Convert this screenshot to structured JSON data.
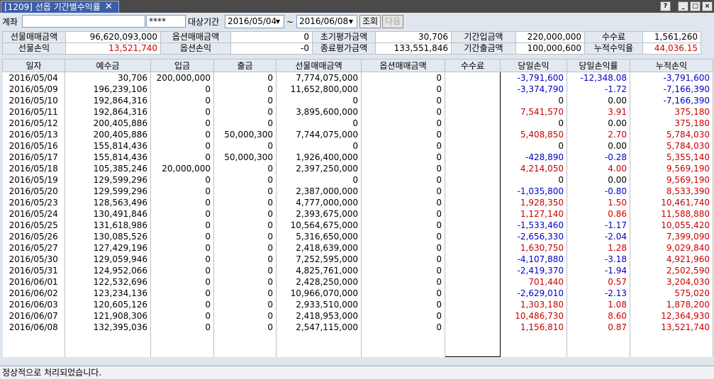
{
  "window": {
    "tab_title": "[1209] 선옵 기간별수익률",
    "help": "?",
    "minimize": "_",
    "restore": "□",
    "close": "×"
  },
  "toolbar": {
    "account_label": "계좌",
    "account_value": "",
    "password_value": "****",
    "period_label": "대상기간",
    "from_date": "2016/05/04",
    "tilde": "~",
    "to_date": "2016/06/08",
    "query_button": "조회",
    "next_button": "다음"
  },
  "summary": {
    "row1": [
      {
        "label": "선물매매금액",
        "value": "96,620,093,000",
        "red": false
      },
      {
        "label": "옵션매매금액",
        "value": "0",
        "red": false
      },
      {
        "label": "초기평가금액",
        "value": "30,706",
        "red": false
      },
      {
        "label": "기간입금액",
        "value": "220,000,000",
        "red": false
      },
      {
        "label": "수수료",
        "value": "1,561,260",
        "red": false
      }
    ],
    "row2": [
      {
        "label": "선물손익",
        "value": "13,521,740",
        "red": true
      },
      {
        "label": "옵션손익",
        "value": "-0",
        "red": false
      },
      {
        "label": "종료평가금액",
        "value": "133,551,846",
        "red": false
      },
      {
        "label": "기간출금액",
        "value": "100,000,600",
        "red": false
      },
      {
        "label": "누적수익율",
        "value": "44,036.15",
        "red": true
      }
    ]
  },
  "grid": {
    "headers": [
      "일자",
      "예수금",
      "입금",
      "출금",
      "선물매매금액",
      "옵션매매금액",
      "수수료",
      "당일손익",
      "당일손익률",
      "누적손익"
    ],
    "rows": [
      {
        "date": "2016/05/04",
        "deposit": "30,706",
        "in": "200,000,000",
        "out": "0",
        "fut": "7,774,075,000",
        "opt": "0",
        "fee": "",
        "pl": "-3,791,600",
        "rate": "-12,348.08",
        "cum": "-3,791,600",
        "plc": "neg",
        "ratec": "neg",
        "cumc": "neg"
      },
      {
        "date": "2016/05/09",
        "deposit": "196,239,106",
        "in": "0",
        "out": "0",
        "fut": "11,652,800,000",
        "opt": "0",
        "fee": "",
        "pl": "-3,374,790",
        "rate": "-1.72",
        "cum": "-7,166,390",
        "plc": "neg",
        "ratec": "neg",
        "cumc": "neg"
      },
      {
        "date": "2016/05/10",
        "deposit": "192,864,316",
        "in": "0",
        "out": "0",
        "fut": "0",
        "opt": "0",
        "fee": "",
        "pl": "0",
        "rate": "0.00",
        "cum": "-7,166,390",
        "plc": "blk",
        "ratec": "blk",
        "cumc": "neg"
      },
      {
        "date": "2016/05/11",
        "deposit": "192,864,316",
        "in": "0",
        "out": "0",
        "fut": "3,895,600,000",
        "opt": "0",
        "fee": "",
        "pl": "7,541,570",
        "rate": "3.91",
        "cum": "375,180",
        "plc": "pos",
        "ratec": "pos",
        "cumc": "pos"
      },
      {
        "date": "2016/05/12",
        "deposit": "200,405,886",
        "in": "0",
        "out": "0",
        "fut": "0",
        "opt": "0",
        "fee": "",
        "pl": "0",
        "rate": "0.00",
        "cum": "375,180",
        "plc": "blk",
        "ratec": "blk",
        "cumc": "pos"
      },
      {
        "date": "2016/05/13",
        "deposit": "200,405,886",
        "in": "0",
        "out": "50,000,300",
        "fut": "7,744,075,000",
        "opt": "0",
        "fee": "",
        "pl": "5,408,850",
        "rate": "2.70",
        "cum": "5,784,030",
        "plc": "pos",
        "ratec": "pos",
        "cumc": "pos"
      },
      {
        "date": "2016/05/16",
        "deposit": "155,814,436",
        "in": "0",
        "out": "0",
        "fut": "0",
        "opt": "0",
        "fee": "",
        "pl": "0",
        "rate": "0.00",
        "cum": "5,784,030",
        "plc": "blk",
        "ratec": "blk",
        "cumc": "pos"
      },
      {
        "date": "2016/05/17",
        "deposit": "155,814,436",
        "in": "0",
        "out": "50,000,300",
        "fut": "1,926,400,000",
        "opt": "0",
        "fee": "",
        "pl": "-428,890",
        "rate": "-0.28",
        "cum": "5,355,140",
        "plc": "neg",
        "ratec": "neg",
        "cumc": "pos"
      },
      {
        "date": "2016/05/18",
        "deposit": "105,385,246",
        "in": "20,000,000",
        "out": "0",
        "fut": "2,397,250,000",
        "opt": "0",
        "fee": "",
        "pl": "4,214,050",
        "rate": "4.00",
        "cum": "9,569,190",
        "plc": "pos",
        "ratec": "pos",
        "cumc": "pos"
      },
      {
        "date": "2016/05/19",
        "deposit": "129,599,296",
        "in": "0",
        "out": "0",
        "fut": "0",
        "opt": "0",
        "fee": "",
        "pl": "0",
        "rate": "0.00",
        "cum": "9,569,190",
        "plc": "blk",
        "ratec": "blk",
        "cumc": "pos"
      },
      {
        "date": "2016/05/20",
        "deposit": "129,599,296",
        "in": "0",
        "out": "0",
        "fut": "2,387,000,000",
        "opt": "0",
        "fee": "",
        "pl": "-1,035,800",
        "rate": "-0.80",
        "cum": "8,533,390",
        "plc": "neg",
        "ratec": "neg",
        "cumc": "pos"
      },
      {
        "date": "2016/05/23",
        "deposit": "128,563,496",
        "in": "0",
        "out": "0",
        "fut": "4,777,000,000",
        "opt": "0",
        "fee": "",
        "pl": "1,928,350",
        "rate": "1.50",
        "cum": "10,461,740",
        "plc": "pos",
        "ratec": "pos",
        "cumc": "pos"
      },
      {
        "date": "2016/05/24",
        "deposit": "130,491,846",
        "in": "0",
        "out": "0",
        "fut": "2,393,675,000",
        "opt": "0",
        "fee": "",
        "pl": "1,127,140",
        "rate": "0.86",
        "cum": "11,588,880",
        "plc": "pos",
        "ratec": "pos",
        "cumc": "pos"
      },
      {
        "date": "2016/05/25",
        "deposit": "131,618,986",
        "in": "0",
        "out": "0",
        "fut": "10,564,675,000",
        "opt": "0",
        "fee": "",
        "pl": "-1,533,460",
        "rate": "-1.17",
        "cum": "10,055,420",
        "plc": "neg",
        "ratec": "neg",
        "cumc": "pos"
      },
      {
        "date": "2016/05/26",
        "deposit": "130,085,526",
        "in": "0",
        "out": "0",
        "fut": "5,316,650,000",
        "opt": "0",
        "fee": "",
        "pl": "-2,656,330",
        "rate": "-2.04",
        "cum": "7,399,090",
        "plc": "neg",
        "ratec": "neg",
        "cumc": "pos"
      },
      {
        "date": "2016/05/27",
        "deposit": "127,429,196",
        "in": "0",
        "out": "0",
        "fut": "2,418,639,000",
        "opt": "0",
        "fee": "",
        "pl": "1,630,750",
        "rate": "1.28",
        "cum": "9,029,840",
        "plc": "pos",
        "ratec": "pos",
        "cumc": "pos"
      },
      {
        "date": "2016/05/30",
        "deposit": "129,059,946",
        "in": "0",
        "out": "0",
        "fut": "7,252,595,000",
        "opt": "0",
        "fee": "",
        "pl": "-4,107,880",
        "rate": "-3.18",
        "cum": "4,921,960",
        "plc": "neg",
        "ratec": "neg",
        "cumc": "pos"
      },
      {
        "date": "2016/05/31",
        "deposit": "124,952,066",
        "in": "0",
        "out": "0",
        "fut": "4,825,761,000",
        "opt": "0",
        "fee": "",
        "pl": "-2,419,370",
        "rate": "-1.94",
        "cum": "2,502,590",
        "plc": "neg",
        "ratec": "neg",
        "cumc": "pos"
      },
      {
        "date": "2016/06/01",
        "deposit": "122,532,696",
        "in": "0",
        "out": "0",
        "fut": "2,428,250,000",
        "opt": "0",
        "fee": "",
        "pl": "701,440",
        "rate": "0.57",
        "cum": "3,204,030",
        "plc": "pos",
        "ratec": "pos",
        "cumc": "pos"
      },
      {
        "date": "2016/06/02",
        "deposit": "123,234,136",
        "in": "0",
        "out": "0",
        "fut": "10,966,070,000",
        "opt": "0",
        "fee": "",
        "pl": "-2,629,010",
        "rate": "-2.13",
        "cum": "575,020",
        "plc": "neg",
        "ratec": "neg",
        "cumc": "pos"
      },
      {
        "date": "2016/06/03",
        "deposit": "120,605,126",
        "in": "0",
        "out": "0",
        "fut": "2,933,510,000",
        "opt": "0",
        "fee": "",
        "pl": "1,303,180",
        "rate": "1.08",
        "cum": "1,878,200",
        "plc": "pos",
        "ratec": "pos",
        "cumc": "pos"
      },
      {
        "date": "2016/06/07",
        "deposit": "121,908,306",
        "in": "0",
        "out": "0",
        "fut": "2,418,953,000",
        "opt": "0",
        "fee": "",
        "pl": "10,486,730",
        "rate": "8.60",
        "cum": "12,364,930",
        "plc": "pos",
        "ratec": "pos",
        "cumc": "pos"
      },
      {
        "date": "2016/06/08",
        "deposit": "132,395,036",
        "in": "0",
        "out": "0",
        "fut": "2,547,115,000",
        "opt": "0",
        "fee": "",
        "pl": "1,156,810",
        "rate": "0.87",
        "cum": "13,521,740",
        "plc": "pos",
        "ratec": "pos",
        "cumc": "pos"
      }
    ]
  },
  "status": {
    "message": "정상적으로 처리되었습니다."
  },
  "colors": {
    "positive": "#c80000",
    "negative": "#0000c8",
    "header_bg": "#e3e9ef",
    "tab_bg": "#3d5ea8"
  }
}
